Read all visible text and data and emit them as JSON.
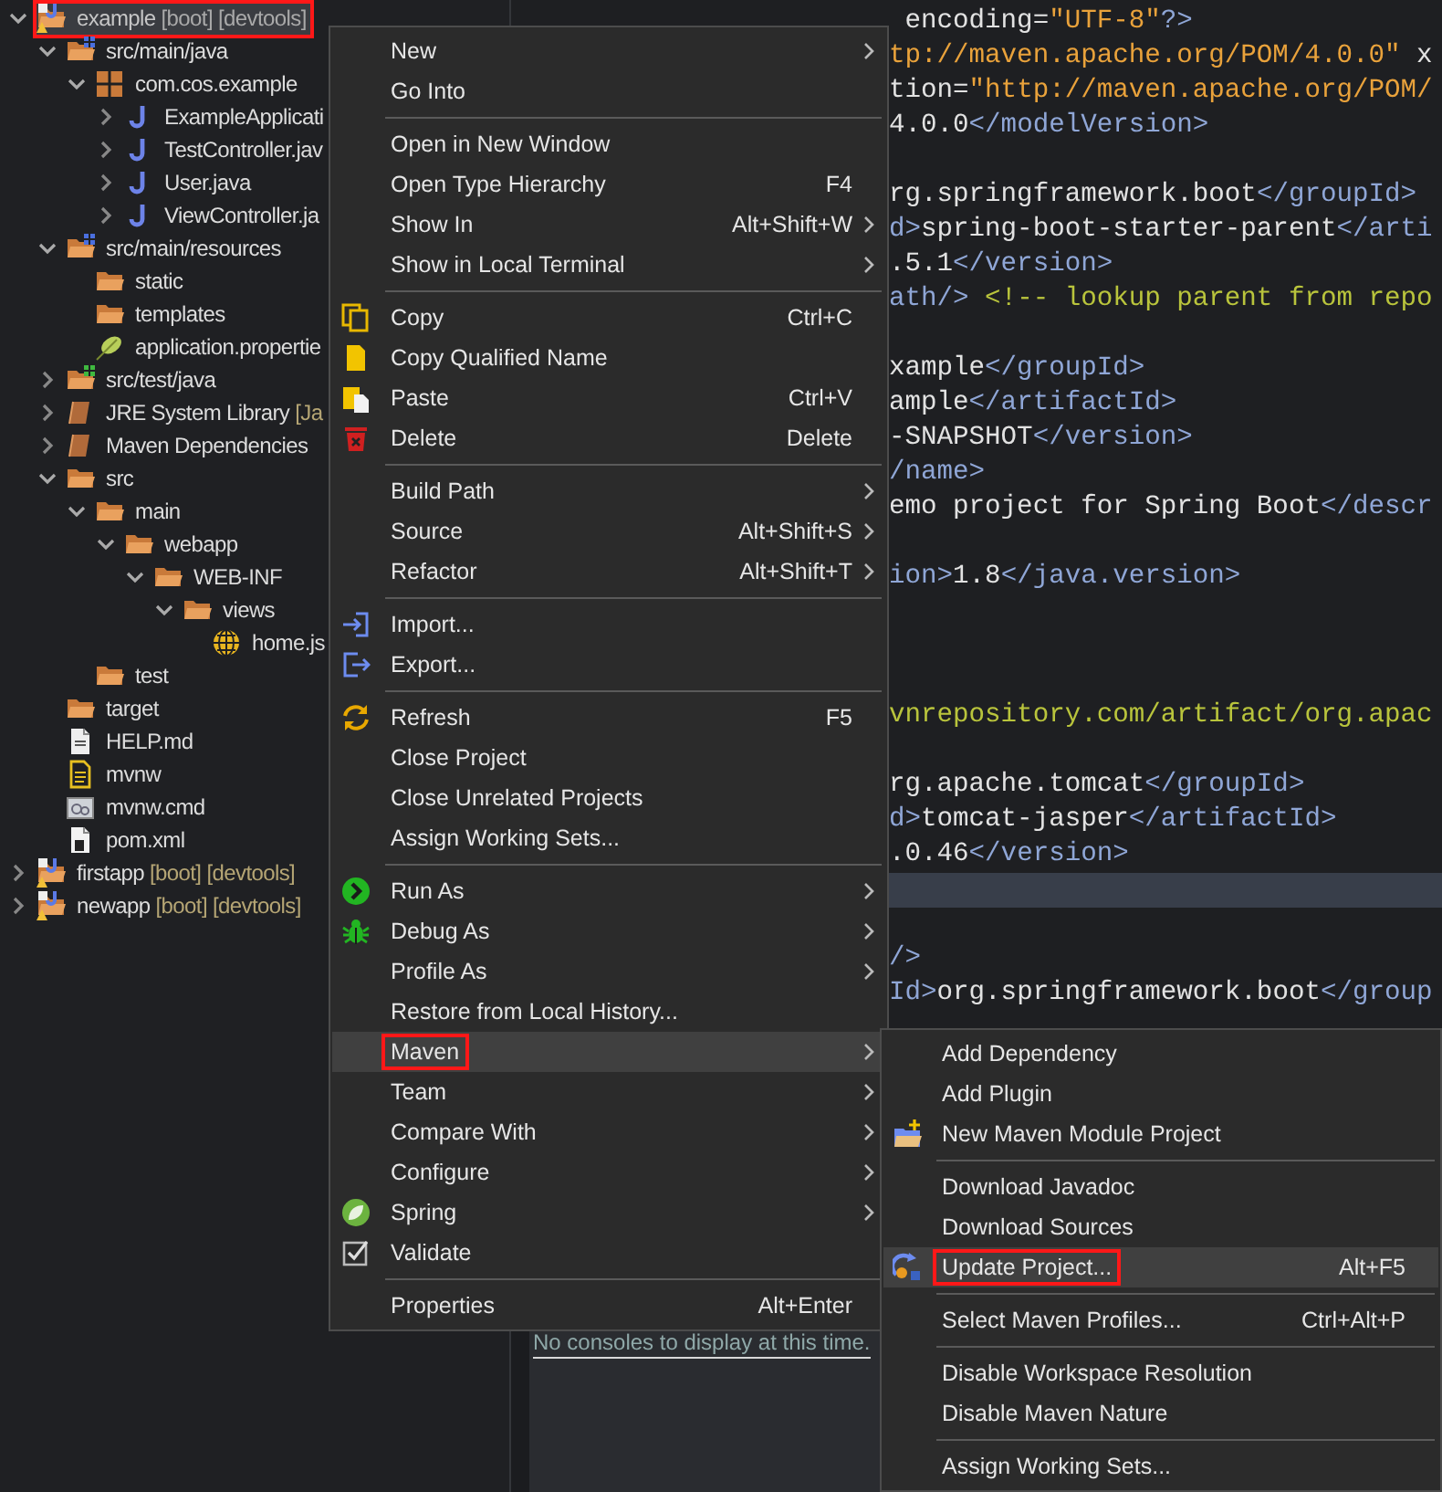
{
  "tree": [
    {
      "label": "example",
      "decoration": "[boot] [devtools]",
      "kind": "project",
      "expanded": true,
      "selected": true,
      "outlined": true,
      "children": [
        {
          "label": "src/main/java",
          "kind": "source-folder",
          "expanded": true,
          "selected": false,
          "outlined": false,
          "children": [
            {
              "label": "com.cos.example",
              "kind": "package",
              "expanded": true,
              "selected": false,
              "outlined": false,
              "children": [
                {
                  "label": "ExampleApplicati",
                  "kind": "java",
                  "expanded": false,
                  "selected": false,
                  "outlined": false
                },
                {
                  "label": "TestController.jav",
                  "kind": "java",
                  "expanded": false,
                  "selected": false,
                  "outlined": false
                },
                {
                  "label": "User.java",
                  "kind": "java",
                  "expanded": false,
                  "selected": false,
                  "outlined": false
                },
                {
                  "label": "ViewController.ja",
                  "kind": "java",
                  "expanded": false,
                  "selected": false,
                  "outlined": false
                }
              ]
            }
          ]
        },
        {
          "label": "src/main/resources",
          "kind": "source-folder",
          "expanded": true,
          "selected": false,
          "outlined": false,
          "children": [
            {
              "label": "static",
              "kind": "folder",
              "selected": false,
              "outlined": false
            },
            {
              "label": "templates",
              "kind": "folder",
              "selected": false,
              "outlined": false
            },
            {
              "label": "application.propertie",
              "kind": "properties",
              "selected": false,
              "outlined": false
            }
          ]
        },
        {
          "label": "src/test/java",
          "kind": "test-folder",
          "expanded": false,
          "selected": false,
          "outlined": false
        },
        {
          "label": "JRE System Library",
          "decoration": "[Ja",
          "kind": "library",
          "expanded": false,
          "selected": false,
          "outlined": false
        },
        {
          "label": "Maven Dependencies",
          "kind": "library",
          "expanded": false,
          "selected": false,
          "outlined": false
        },
        {
          "label": "src",
          "kind": "folder",
          "expanded": true,
          "selected": false,
          "outlined": false,
          "children": [
            {
              "label": "main",
              "kind": "folder",
              "expanded": true,
              "selected": false,
              "outlined": false,
              "children": [
                {
                  "label": "webapp",
                  "kind": "folder",
                  "expanded": true,
                  "selected": false,
                  "outlined": false,
                  "children": [
                    {
                      "label": "WEB-INF",
                      "kind": "folder",
                      "expanded": true,
                      "selected": false,
                      "outlined": false,
                      "children": [
                        {
                          "label": "views",
                          "kind": "folder",
                          "expanded": true,
                          "selected": false,
                          "outlined": false,
                          "children": [
                            {
                              "label": "home.js",
                              "kind": "jsp",
                              "selected": false,
                              "outlined": false
                            }
                          ]
                        }
                      ]
                    }
                  ]
                }
              ]
            },
            {
              "label": "test",
              "kind": "folder",
              "selected": false,
              "outlined": false
            }
          ]
        },
        {
          "label": "target",
          "kind": "folder",
          "selected": false,
          "outlined": false
        },
        {
          "label": "HELP.md",
          "kind": "markdown",
          "selected": false,
          "outlined": false
        },
        {
          "label": "mvnw",
          "kind": "script",
          "selected": false,
          "outlined": false
        },
        {
          "label": "mvnw.cmd",
          "kind": "cmd",
          "selected": false,
          "outlined": false
        },
        {
          "label": "pom.xml",
          "kind": "pom",
          "selected": false,
          "outlined": false
        }
      ]
    },
    {
      "label": "firstapp",
      "decoration": "[boot] [devtools]",
      "kind": "project",
      "expanded": false,
      "selected": false,
      "outlined": false
    },
    {
      "label": "newapp",
      "decoration": "[boot] [devtools]",
      "kind": "project",
      "expanded": false,
      "selected": false,
      "outlined": false
    }
  ],
  "editor": {
    "lines": [
      {
        "current": false,
        "segments": [
          {
            "kind": "text",
            "text": " encoding="
          },
          {
            "kind": "string",
            "text": "\"UTF-8\""
          },
          {
            "kind": "tag",
            "text": "?>"
          }
        ]
      },
      {
        "current": false,
        "segments": [
          {
            "kind": "string",
            "text": "tp://maven.apache.org/POM/4.0.0\""
          },
          {
            "kind": "text",
            "text": " x"
          }
        ]
      },
      {
        "current": false,
        "segments": [
          {
            "kind": "text",
            "text": "tion="
          },
          {
            "kind": "string",
            "text": "\"http://maven.apache.org/POM/"
          }
        ]
      },
      {
        "current": false,
        "segments": [
          {
            "kind": "text",
            "text": "4.0.0"
          },
          {
            "kind": "tag",
            "text": "</modelVersion>"
          }
        ]
      },
      {
        "current": false
      },
      {
        "current": false,
        "segments": [
          {
            "kind": "text",
            "text": "rg.springframework.boot"
          },
          {
            "kind": "tag",
            "text": "</groupId>"
          }
        ]
      },
      {
        "current": false,
        "segments": [
          {
            "kind": "tag",
            "text": "d>"
          },
          {
            "kind": "text",
            "text": "spring-boot-starter-parent"
          },
          {
            "kind": "tag",
            "text": "</arti"
          }
        ]
      },
      {
        "current": false,
        "segments": [
          {
            "kind": "text",
            "text": ".5.1"
          },
          {
            "kind": "tag",
            "text": "</version>"
          }
        ]
      },
      {
        "current": false,
        "segments": [
          {
            "kind": "tag",
            "text": "ath/>"
          },
          {
            "kind": "comment",
            "text": " <!-- lookup parent from repo"
          }
        ]
      },
      {
        "current": false
      },
      {
        "current": false,
        "segments": [
          {
            "kind": "text",
            "text": "xample"
          },
          {
            "kind": "tag",
            "text": "</groupId>"
          }
        ]
      },
      {
        "current": false,
        "segments": [
          {
            "kind": "text",
            "text": "ample"
          },
          {
            "kind": "tag",
            "text": "</artifactId>"
          }
        ]
      },
      {
        "current": false,
        "segments": [
          {
            "kind": "text",
            "text": "-SNAPSHOT"
          },
          {
            "kind": "tag",
            "text": "</version>"
          }
        ]
      },
      {
        "current": false,
        "segments": [
          {
            "kind": "tag",
            "text": "/name>"
          }
        ]
      },
      {
        "current": false,
        "segments": [
          {
            "kind": "text",
            "text": "emo project for Spring Boot"
          },
          {
            "kind": "tag",
            "text": "</descr"
          }
        ]
      },
      {
        "current": false
      },
      {
        "current": false,
        "segments": [
          {
            "kind": "tag",
            "text": "ion>"
          },
          {
            "kind": "text",
            "text": "1.8"
          },
          {
            "kind": "tag",
            "text": "</java.version>"
          }
        ]
      },
      {
        "current": false
      },
      {
        "current": false
      },
      {
        "current": false
      },
      {
        "current": false,
        "segments": [
          {
            "kind": "comment",
            "text": "vnrepository.com/artifact/org.apac"
          }
        ]
      },
      {
        "current": false
      },
      {
        "current": false,
        "segments": [
          {
            "kind": "text",
            "text": "rg.apache.tomcat"
          },
          {
            "kind": "tag",
            "text": "</groupId>"
          }
        ]
      },
      {
        "current": false,
        "segments": [
          {
            "kind": "tag",
            "text": "d>"
          },
          {
            "kind": "text",
            "text": "tomcat-jasper"
          },
          {
            "kind": "tag",
            "text": "</artifactId>"
          }
        ]
      },
      {
        "current": false,
        "segments": [
          {
            "kind": "text",
            "text": ".0.46"
          },
          {
            "kind": "tag",
            "text": "</version>"
          }
        ]
      },
      {
        "current": true
      },
      {
        "current": false
      },
      {
        "current": false,
        "segments": [
          {
            "kind": "tag",
            "text": "/>"
          }
        ]
      },
      {
        "current": false,
        "segments": [
          {
            "kind": "tag",
            "text": "Id>"
          },
          {
            "kind": "text",
            "text": "org.springframework.boot"
          },
          {
            "kind": "tag",
            "text": "</group"
          }
        ]
      }
    ]
  },
  "console": {
    "message": "No consoles to display at this time."
  },
  "context_menu": [
    {
      "kind": "item",
      "label": "New",
      "submenu": true,
      "selected": false,
      "outlined": false
    },
    {
      "kind": "item",
      "label": "Go Into",
      "submenu": false,
      "selected": false,
      "outlined": false
    },
    {
      "kind": "separator"
    },
    {
      "kind": "item",
      "label": "Open in New Window",
      "submenu": false,
      "selected": false,
      "outlined": false
    },
    {
      "kind": "item",
      "label": "Open Type Hierarchy",
      "shortcut": "F4",
      "submenu": false,
      "selected": false,
      "outlined": false
    },
    {
      "kind": "item",
      "label": "Show In",
      "shortcut": "Alt+Shift+W",
      "submenu": true,
      "selected": false,
      "outlined": false
    },
    {
      "kind": "item",
      "label": "Show in Local Terminal",
      "submenu": true,
      "selected": false,
      "outlined": false
    },
    {
      "kind": "separator"
    },
    {
      "kind": "copy",
      "label": "Copy",
      "shortcut": "Ctrl+C",
      "submenu": false,
      "selected": false,
      "outlined": false
    },
    {
      "kind": "copy-name",
      "label": "Copy Qualified Name",
      "submenu": false,
      "selected": false,
      "outlined": false
    },
    {
      "kind": "paste",
      "label": "Paste",
      "shortcut": "Ctrl+V",
      "submenu": false,
      "selected": false,
      "outlined": false
    },
    {
      "kind": "delete",
      "label": "Delete",
      "shortcut": "Delete",
      "submenu": false,
      "selected": false,
      "outlined": false
    },
    {
      "kind": "separator"
    },
    {
      "kind": "item",
      "label": "Build Path",
      "submenu": true,
      "selected": false,
      "outlined": false
    },
    {
      "kind": "item",
      "label": "Source",
      "shortcut": "Alt+Shift+S",
      "submenu": true,
      "selected": false,
      "outlined": false
    },
    {
      "kind": "item",
      "label": "Refactor",
      "shortcut": "Alt+Shift+T",
      "submenu": true,
      "selected": false,
      "outlined": false
    },
    {
      "kind": "separator"
    },
    {
      "kind": "import",
      "label": "Import...",
      "submenu": false,
      "selected": false,
      "outlined": false
    },
    {
      "kind": "export",
      "label": "Export...",
      "submenu": false,
      "selected": false,
      "outlined": false
    },
    {
      "kind": "separator"
    },
    {
      "kind": "refresh",
      "label": "Refresh",
      "shortcut": "F5",
      "submenu": false,
      "selected": false,
      "outlined": false
    },
    {
      "kind": "item",
      "label": "Close Project",
      "submenu": false,
      "selected": false,
      "outlined": false
    },
    {
      "kind": "item",
      "label": "Close Unrelated Projects",
      "submenu": false,
      "selected": false,
      "outlined": false
    },
    {
      "kind": "item",
      "label": "Assign Working Sets...",
      "submenu": false,
      "selected": false,
      "outlined": false
    },
    {
      "kind": "separator"
    },
    {
      "kind": "run",
      "label": "Run As",
      "submenu": true,
      "selected": false,
      "outlined": false
    },
    {
      "kind": "debug",
      "label": "Debug As",
      "submenu": true,
      "selected": false,
      "outlined": false
    },
    {
      "kind": "item",
      "label": "Profile As",
      "submenu": true,
      "selected": false,
      "outlined": false
    },
    {
      "kind": "item",
      "label": "Restore from Local History...",
      "submenu": false,
      "selected": false,
      "outlined": false
    },
    {
      "kind": "item",
      "label": "Maven",
      "submenu": true,
      "selected": true,
      "outlined": true
    },
    {
      "kind": "item",
      "label": "Team",
      "submenu": true,
      "selected": false,
      "outlined": false
    },
    {
      "kind": "item",
      "label": "Compare With",
      "submenu": true,
      "selected": false,
      "outlined": false
    },
    {
      "kind": "item",
      "label": "Configure",
      "submenu": true,
      "selected": false,
      "outlined": false
    },
    {
      "kind": "spring",
      "label": "Spring",
      "submenu": true,
      "selected": false,
      "outlined": false
    },
    {
      "kind": "validate",
      "label": "Validate",
      "submenu": false,
      "selected": false,
      "outlined": false
    },
    {
      "kind": "separator"
    },
    {
      "kind": "item",
      "label": "Properties",
      "shortcut": "Alt+Enter",
      "submenu": false,
      "selected": false,
      "outlined": false
    }
  ],
  "maven_submenu": [
    {
      "kind": "item",
      "label": "Add Dependency",
      "submenu": false,
      "selected": false,
      "outlined": false
    },
    {
      "kind": "item",
      "label": "Add Plugin",
      "submenu": false,
      "selected": false,
      "outlined": false
    },
    {
      "kind": "maven-module",
      "label": "New Maven Module Project",
      "submenu": false,
      "selected": false,
      "outlined": false
    },
    {
      "kind": "separator"
    },
    {
      "kind": "item",
      "label": "Download Javadoc",
      "submenu": false,
      "selected": false,
      "outlined": false
    },
    {
      "kind": "item",
      "label": "Download Sources",
      "submenu": false,
      "selected": false,
      "outlined": false
    },
    {
      "kind": "update",
      "label": "Update Project...",
      "shortcut": "Alt+F5",
      "submenu": false,
      "selected": true,
      "outlined": true
    },
    {
      "kind": "separator"
    },
    {
      "kind": "item",
      "label": "Select Maven Profiles...",
      "shortcut": "Ctrl+Alt+P",
      "submenu": false,
      "selected": false,
      "outlined": false
    },
    {
      "kind": "separator"
    },
    {
      "kind": "item",
      "label": "Disable Workspace Resolution",
      "submenu": false,
      "selected": false,
      "outlined": false
    },
    {
      "kind": "item",
      "label": "Disable Maven Nature",
      "submenu": false,
      "selected": false,
      "outlined": false
    },
    {
      "kind": "separator"
    },
    {
      "kind": "item",
      "label": "Assign Working Sets...",
      "submenu": false,
      "selected": false,
      "outlined": false
    }
  ]
}
